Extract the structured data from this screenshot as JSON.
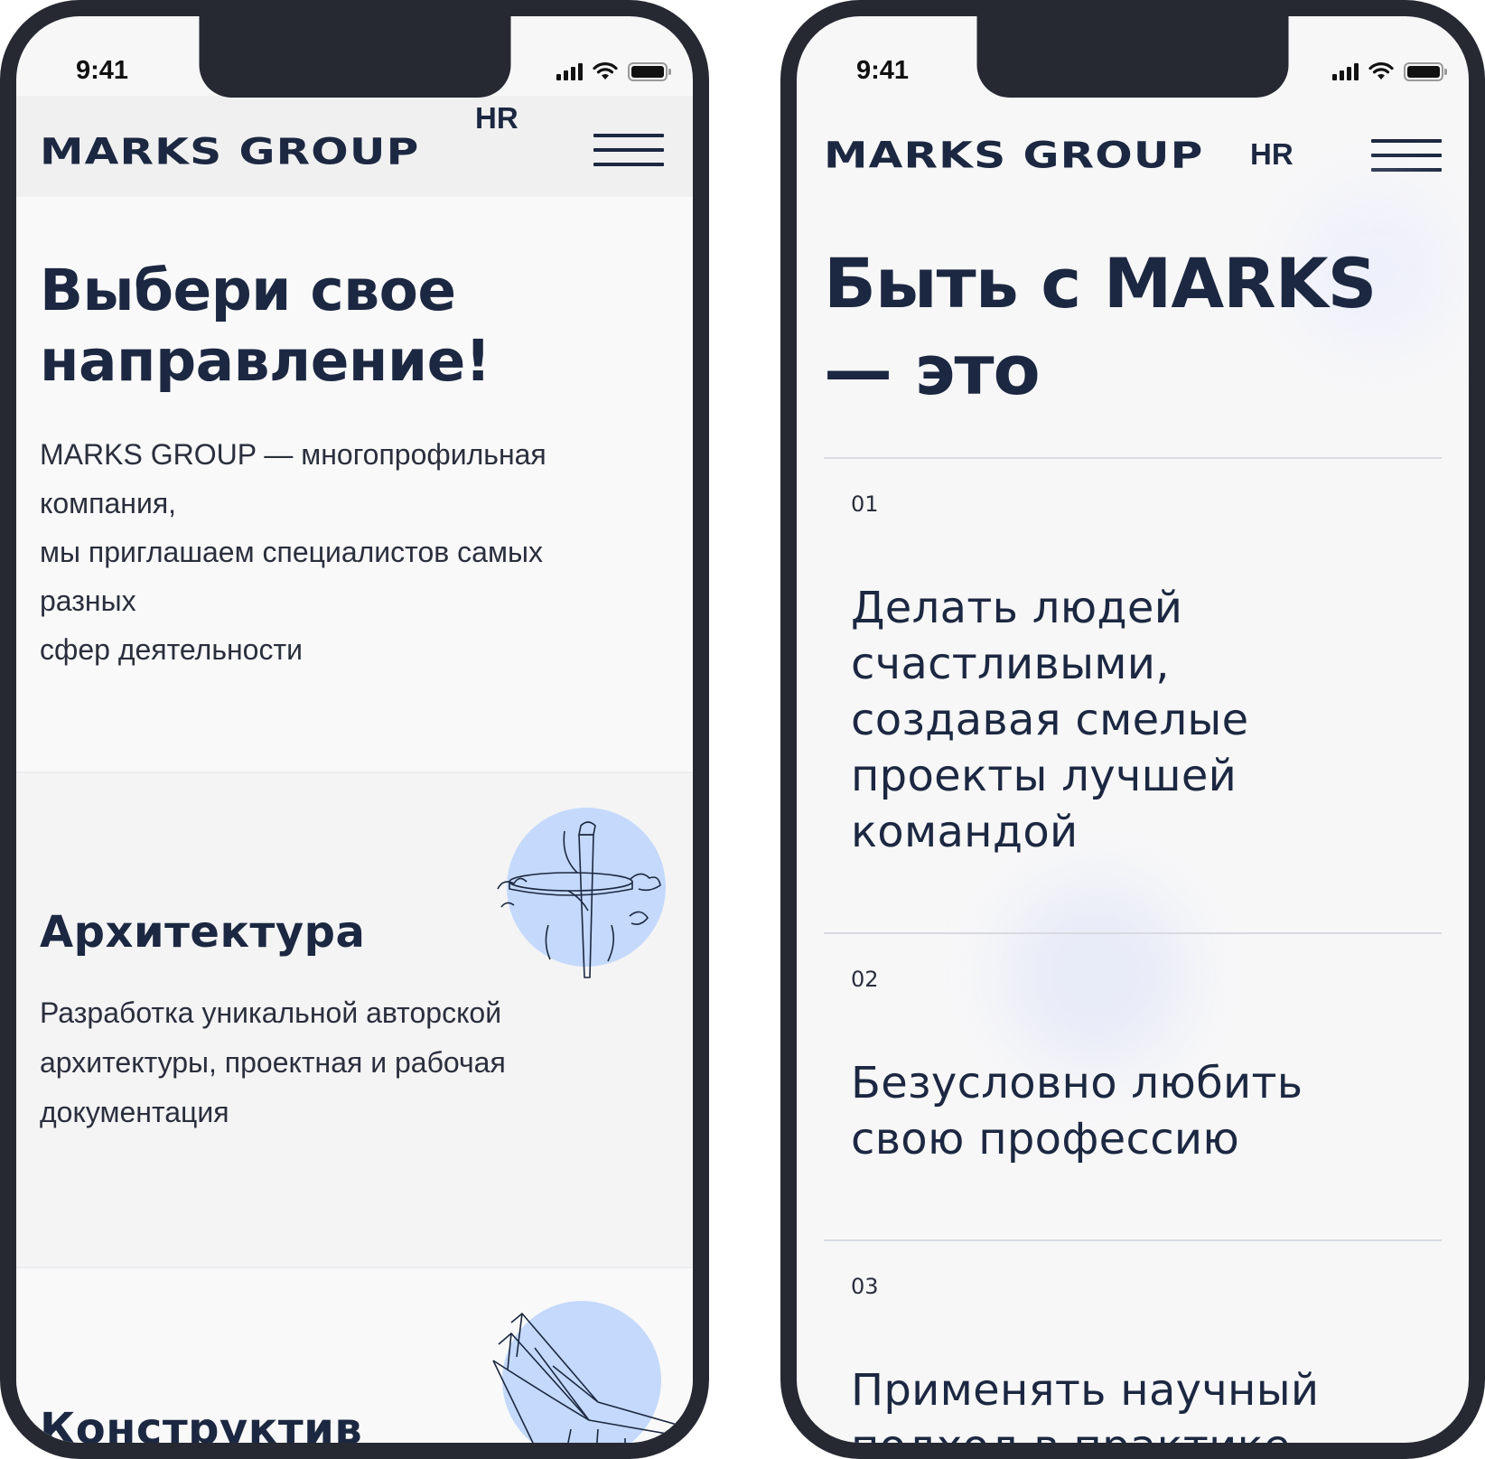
{
  "status_bar": {
    "time": "9:41"
  },
  "header": {
    "logo": "MARKS GROUP",
    "suffix": "HR"
  },
  "left_screen": {
    "intro": {
      "title": "Выбери свое направление!",
      "text": "MARKS GROUP — многопрофильная компания,\nмы приглашаем специалистов самых разных\nсфер деятельности"
    },
    "cards": [
      {
        "title": "Архитектура",
        "text": "Разработка уникальной авторской архитектуры, проектная и рабочая документация",
        "illustration": "tower-illustration"
      },
      {
        "title": "Конструктив",
        "illustration": "stadium-illustration"
      }
    ]
  },
  "right_screen": {
    "title": "Быть с MARKS — это",
    "values": [
      {
        "num": "01",
        "text": "Делать людей счастливыми, создавая смелые проекты лучшей командой"
      },
      {
        "num": "02",
        "text": "Безусловно любить свою профессию"
      },
      {
        "num": "03",
        "text": "Применять научный подход в практике"
      }
    ]
  },
  "colors": {
    "brand": "#1c2841",
    "frame": "#262932",
    "accent_circle": "#c4d9fb",
    "screen_bg": "#f7f7f8"
  }
}
